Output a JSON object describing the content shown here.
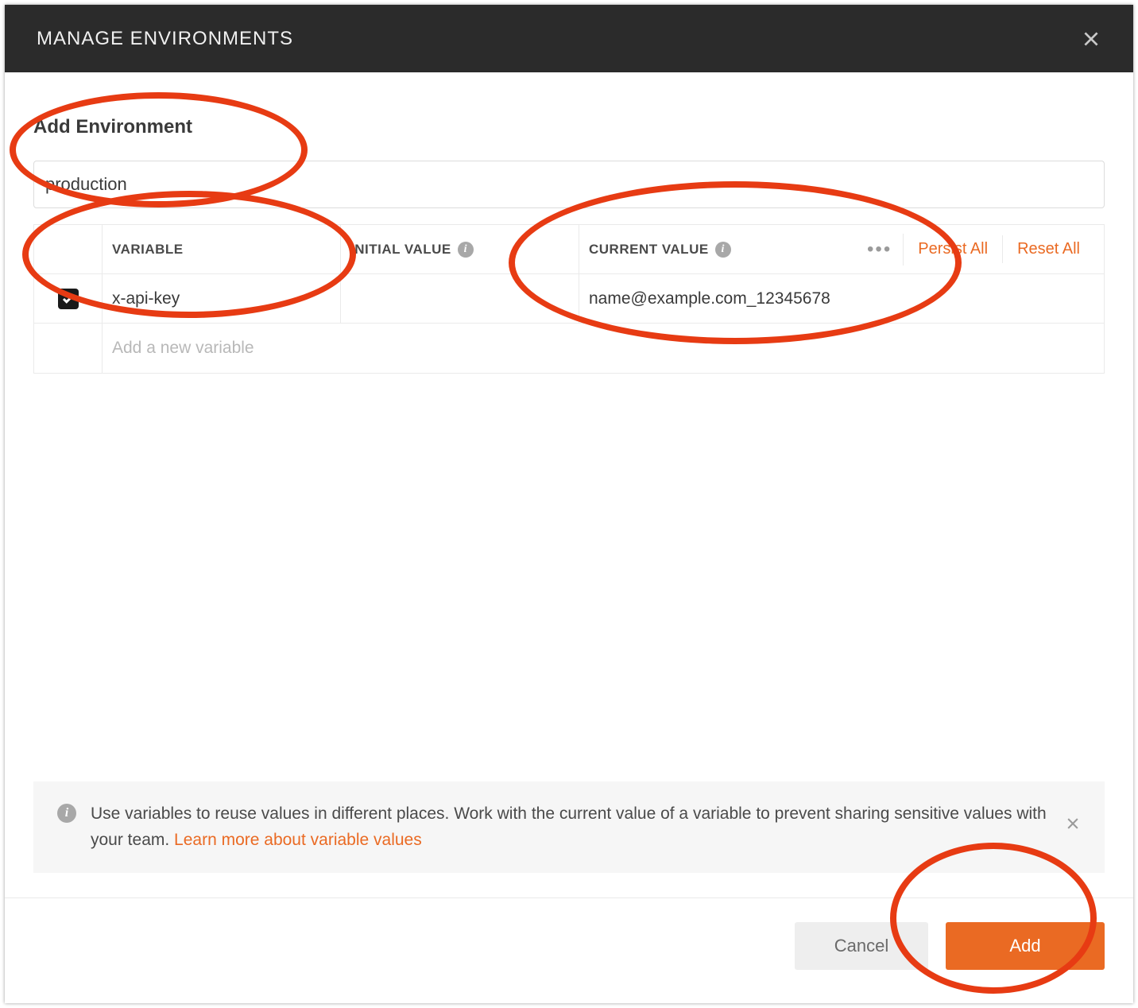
{
  "header": {
    "title": "MANAGE ENVIRONMENTS"
  },
  "section": {
    "title": "Add Environment",
    "env_name": "production"
  },
  "table": {
    "headers": {
      "variable": "VARIABLE",
      "initial": "INITIAL VALUE",
      "current": "CURRENT VALUE"
    },
    "actions": {
      "persist": "Persist All",
      "reset": "Reset All"
    },
    "rows": [
      {
        "checked": true,
        "variable": "x-api-key",
        "initial": "",
        "current": "name@example.com_12345678"
      }
    ],
    "placeholder": "Add a new variable"
  },
  "banner": {
    "text": "Use variables to reuse values in different places. Work with the current value of a variable to prevent sharing sensitive values with your team. ",
    "link": "Learn more about variable values"
  },
  "footer": {
    "cancel": "Cancel",
    "add": "Add"
  },
  "colors": {
    "accent": "#ea6a23",
    "annotation": "#e73b13"
  }
}
